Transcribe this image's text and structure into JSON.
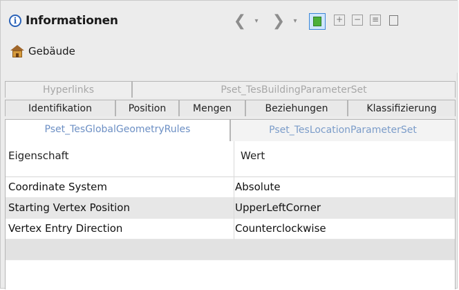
{
  "panel": {
    "info_glyph": "i",
    "title": "Informationen",
    "subject": "Gebäude"
  },
  "toolbar": {
    "back_glyph": "❮",
    "back_dropdown_glyph": "▾",
    "forward_glyph": "❯",
    "forward_dropdown_glyph": "▾",
    "expand_glyph": "+",
    "collapse_glyph": "−",
    "list_glyph": "≡"
  },
  "tabs": {
    "row1": [
      "Hyperlinks",
      "Pset_TesBuildingParameterSet"
    ],
    "row2": [
      "Identifikation",
      "Position",
      "Mengen",
      "Beziehungen",
      "Klassifizierung"
    ],
    "row3": [
      "Pset_TesGlobalGeometryRules",
      "Pset_TesLocationParameterSet"
    ]
  },
  "table": {
    "headers": [
      "Eigenschaft",
      "Wert"
    ],
    "rows": [
      [
        "Coordinate System",
        "Absolute"
      ],
      [
        "Starting Vertex Position",
        "UpperLeftCorner"
      ],
      [
        "Vertex Entry Direction",
        "Counterclockwise"
      ]
    ]
  }
}
